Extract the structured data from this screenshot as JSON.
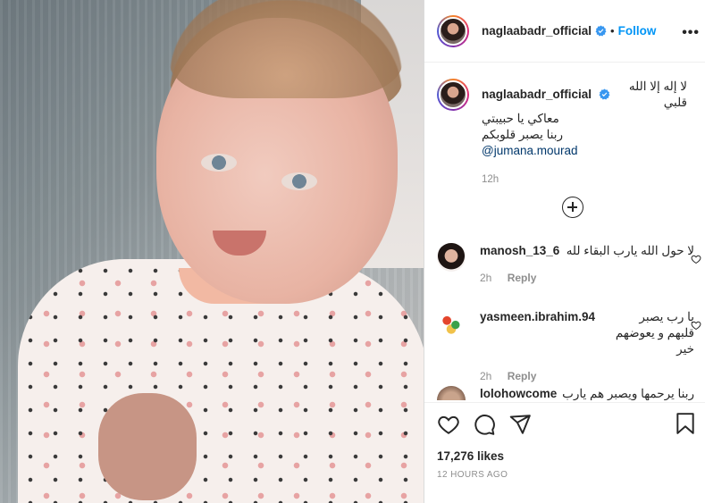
{
  "post": {
    "username": "naglaabadr_official",
    "follow_label": "Follow",
    "dot": "•",
    "more_label": "•••"
  },
  "caption": {
    "line1": "لا إله إلا الله قلبي",
    "line2": "معاكي يا حبيبتي",
    "line3": "ربنا يصبر قلوبكم",
    "mention": "@jumana.mourad",
    "time": "12h"
  },
  "comments": [
    {
      "user": "manosh_13_6",
      "text": "لا حول الله يارب البقاء لله",
      "time": "2h",
      "reply": "Reply"
    },
    {
      "user": "yasmeen.ibrahim.94",
      "text": "يا رب يصبر قلبهم و يعوضهم خير",
      "time": "2h",
      "reply": "Reply"
    },
    {
      "user": "lolohowcome",
      "text": "ربنا يرحمها ويصبر هم يارب"
    }
  ],
  "footer": {
    "likes": "17,276 likes",
    "date": "12 HOURS AGO"
  },
  "colors": {
    "link_blue": "#0095f6",
    "mention_blue": "#00376b",
    "muted": "#8e8e8e",
    "verified_blue": "#3897f0"
  }
}
